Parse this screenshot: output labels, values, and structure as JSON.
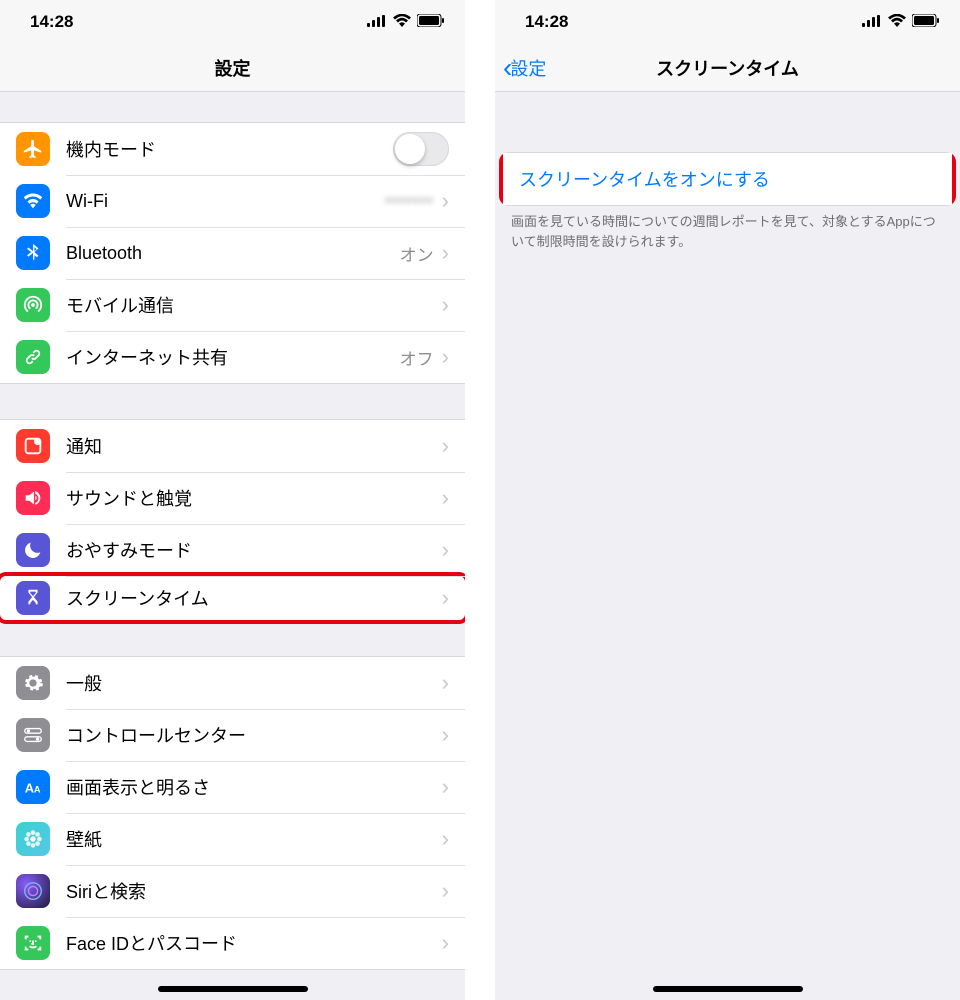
{
  "status": {
    "time": "14:28"
  },
  "left": {
    "title": "設定",
    "groups": [
      [
        {
          "id": "airplane",
          "label": "機内モード",
          "icon": "airplane-icon",
          "bg": "bg-orange",
          "toggle": true
        },
        {
          "id": "wifi",
          "label": "Wi-Fi",
          "icon": "wifi-icon",
          "bg": "bg-blue",
          "value": "•••••••",
          "blur": true,
          "chevron": true
        },
        {
          "id": "bluetooth",
          "label": "Bluetooth",
          "icon": "bluetooth-icon",
          "bg": "bg-btblue",
          "value": "オン",
          "chevron": true
        },
        {
          "id": "cellular",
          "label": "モバイル通信",
          "icon": "antenna-icon",
          "bg": "bg-green",
          "chevron": true
        },
        {
          "id": "hotspot",
          "label": "インターネット共有",
          "icon": "link-icon",
          "bg": "bg-green2",
          "value": "オフ",
          "chevron": true
        }
      ],
      [
        {
          "id": "notifications",
          "label": "通知",
          "icon": "notification-icon",
          "bg": "bg-red",
          "chevron": true
        },
        {
          "id": "sounds",
          "label": "サウンドと触覚",
          "icon": "speaker-icon",
          "bg": "bg-pink",
          "chevron": true
        },
        {
          "id": "dnd",
          "label": "おやすみモード",
          "icon": "moon-icon",
          "bg": "bg-indigo",
          "chevron": true
        },
        {
          "id": "screentime",
          "label": "スクリーンタイム",
          "icon": "hourglass-icon",
          "bg": "bg-purple",
          "chevron": true,
          "highlight": true
        }
      ],
      [
        {
          "id": "general",
          "label": "一般",
          "icon": "gear-icon",
          "bg": "bg-gray",
          "chevron": true
        },
        {
          "id": "controlcenter",
          "label": "コントロールセンター",
          "icon": "switches-icon",
          "bg": "bg-gray2",
          "chevron": true
        },
        {
          "id": "display",
          "label": "画面表示と明るさ",
          "icon": "text-size-icon",
          "bg": "bg-bluetext",
          "chevron": true
        },
        {
          "id": "wallpaper",
          "label": "壁紙",
          "icon": "flower-icon",
          "bg": "bg-teal",
          "chevron": true
        },
        {
          "id": "siri",
          "label": "Siriと検索",
          "icon": "siri-icon",
          "bg": "bg-siri",
          "chevron": true
        },
        {
          "id": "faceid",
          "label": "Face IDとパスコード",
          "icon": "faceid-icon",
          "bg": "bg-faceid",
          "chevron": true
        }
      ]
    ]
  },
  "right": {
    "back": "設定",
    "title": "スクリーンタイム",
    "action": "スクリーンタイムをオンにする",
    "footer": "画面を見ている時間についての週間レポートを見て、対象とするAppについて制限時間を設けられます。"
  }
}
